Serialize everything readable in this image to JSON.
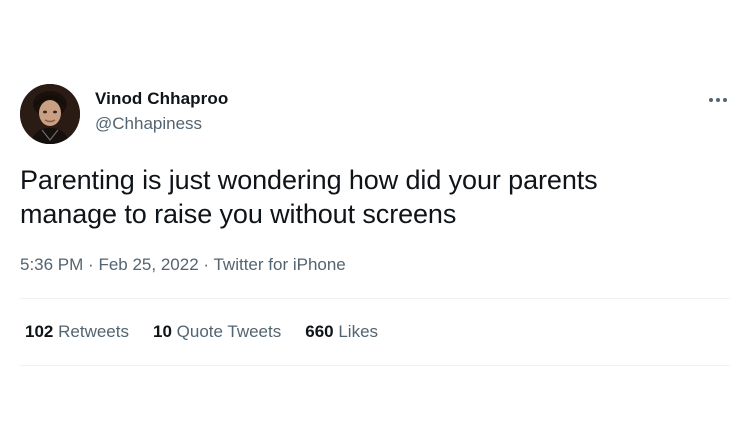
{
  "author": {
    "name": "Vinod Chhaproo",
    "handle": "@Chhapiness"
  },
  "tweet": {
    "text_line1": "Parenting is just wondering how did your parents",
    "text_line2": "manage to raise you without screens",
    "time": "5:36 PM",
    "date": "Feb 25, 2022",
    "source": "Twitter for iPhone",
    "separator": "·"
  },
  "stats": [
    {
      "count": "102",
      "label": "Retweets"
    },
    {
      "count": "10",
      "label": "Quote Tweets"
    },
    {
      "count": "660",
      "label": "Likes"
    }
  ],
  "icons": {
    "more": "more-horizontal-icon"
  },
  "colors": {
    "primary_text": "#0f1419",
    "secondary_text": "#536471",
    "divider": "#eff3f4",
    "background": "#ffffff"
  }
}
